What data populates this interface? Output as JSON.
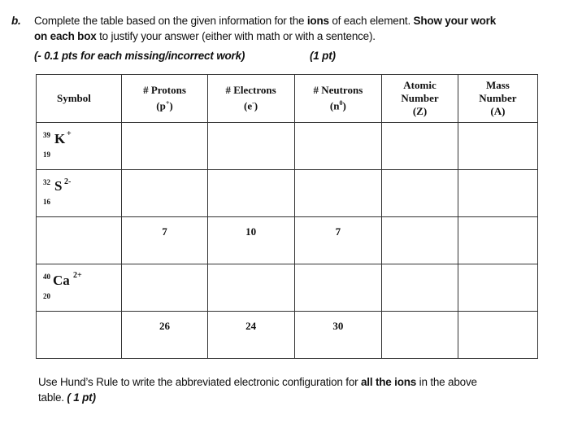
{
  "question": {
    "label": "b.",
    "line1_a": "Complete the table based on the given information for the ",
    "line1_bold1": "ions",
    "line1_b": " of each element. ",
    "line1_bold2": "Show your work",
    "line2_bold": "on each box",
    "line2_rest": " to justify your answer (either with math or with a sentence).",
    "penalty": "(- 0.1 pts for each missing/incorrect work)",
    "points": "(1 pt)"
  },
  "table": {
    "headers": {
      "symbol": "Symbol",
      "protons": "# Protons",
      "protons_unit_base": "(p",
      "protons_unit_sup": "+",
      "electrons": "# Electrons",
      "electrons_unit_base": "(e",
      "electrons_unit_sup": "-",
      "neutrons": "# Neutrons",
      "neutrons_unit_base": "(n",
      "neutrons_unit_sup": "0",
      "atomic_1": "Atomic",
      "atomic_2": "Number",
      "atomic_3": "(Z)",
      "mass_1": "Mass",
      "mass_2": "Number",
      "mass_3": "(A)"
    },
    "rows": [
      {
        "symbol": {
          "mass": "39",
          "atomic": "19",
          "element": "K",
          "charge": "+"
        },
        "protons": "",
        "electrons": "",
        "neutrons": "",
        "atomic_number": "",
        "mass_number": ""
      },
      {
        "symbol": {
          "mass": "32",
          "atomic": "16",
          "element": "S",
          "charge": "2-"
        },
        "protons": "",
        "electrons": "",
        "neutrons": "",
        "atomic_number": "",
        "mass_number": ""
      },
      {
        "symbol": null,
        "protons": "7",
        "electrons": "10",
        "neutrons": "7",
        "atomic_number": "",
        "mass_number": ""
      },
      {
        "symbol": {
          "mass": "40",
          "atomic": "20",
          "element": "Ca",
          "charge": "2+"
        },
        "protons": "",
        "electrons": "",
        "neutrons": "",
        "atomic_number": "",
        "mass_number": ""
      },
      {
        "symbol": null,
        "protons": "26",
        "electrons": "24",
        "neutrons": "30",
        "atomic_number": "",
        "mass_number": ""
      }
    ]
  },
  "hund": {
    "line1_a": "Use Hund’s Rule to write the abbreviated electronic configuration for ",
    "line1_bold": "all the ions",
    "line1_b": " in the above",
    "line2": "table. ",
    "points": "( 1 pt)"
  }
}
